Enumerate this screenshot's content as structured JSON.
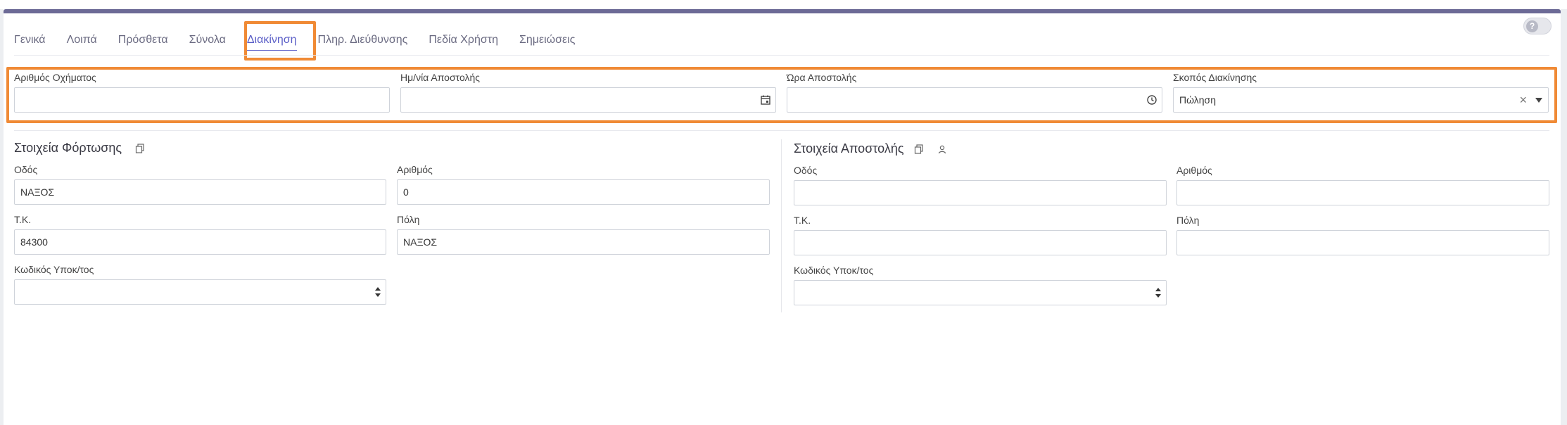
{
  "tabs": [
    {
      "label": "Γενικά"
    },
    {
      "label": "Λοιπά"
    },
    {
      "label": "Πρόσθετα"
    },
    {
      "label": "Σύνολα"
    },
    {
      "label": "Διακίνηση",
      "active": true
    },
    {
      "label": "Πληρ. Διεύθυνσης"
    },
    {
      "label": "Πεδία Χρήστη"
    },
    {
      "label": "Σημειώσεις"
    }
  ],
  "help": {
    "icon": "question-icon",
    "glyph": "?"
  },
  "shipping": {
    "vehicle_label": "Αριθμός Οχήματος",
    "vehicle_value": "",
    "date_label": "Ημ/νία Αποστολής",
    "date_value": "",
    "time_label": "Ώρα Αποστολής",
    "time_value": "",
    "purpose_label": "Σκοπός Διακίνησης",
    "purpose_value": "Πώληση",
    "clear_glyph": "×"
  },
  "loading": {
    "title": "Στοιχεία Φόρτωσης",
    "street_label": "Οδός",
    "street_value": "ΝΑΞΟΣ",
    "number_label": "Αριθμός",
    "number_value": "0",
    "zip_label": "Τ.Κ.",
    "zip_value": "84300",
    "city_label": "Πόλη",
    "city_value": "ΝΑΞΟΣ",
    "branch_label": "Κωδικός Υποκ/τος",
    "branch_value": ""
  },
  "delivery": {
    "title": "Στοιχεία Αποστολής",
    "street_label": "Οδός",
    "street_value": "",
    "number_label": "Αριθμός",
    "number_value": "",
    "zip_label": "Τ.Κ.",
    "zip_value": "",
    "city_label": "Πόλη",
    "city_value": "",
    "branch_label": "Κωδικός Υποκ/τος",
    "branch_value": ""
  },
  "colors": {
    "accent": "#5b5fc7",
    "highlight": "#f08a35",
    "topbar": "#6c6a96"
  }
}
